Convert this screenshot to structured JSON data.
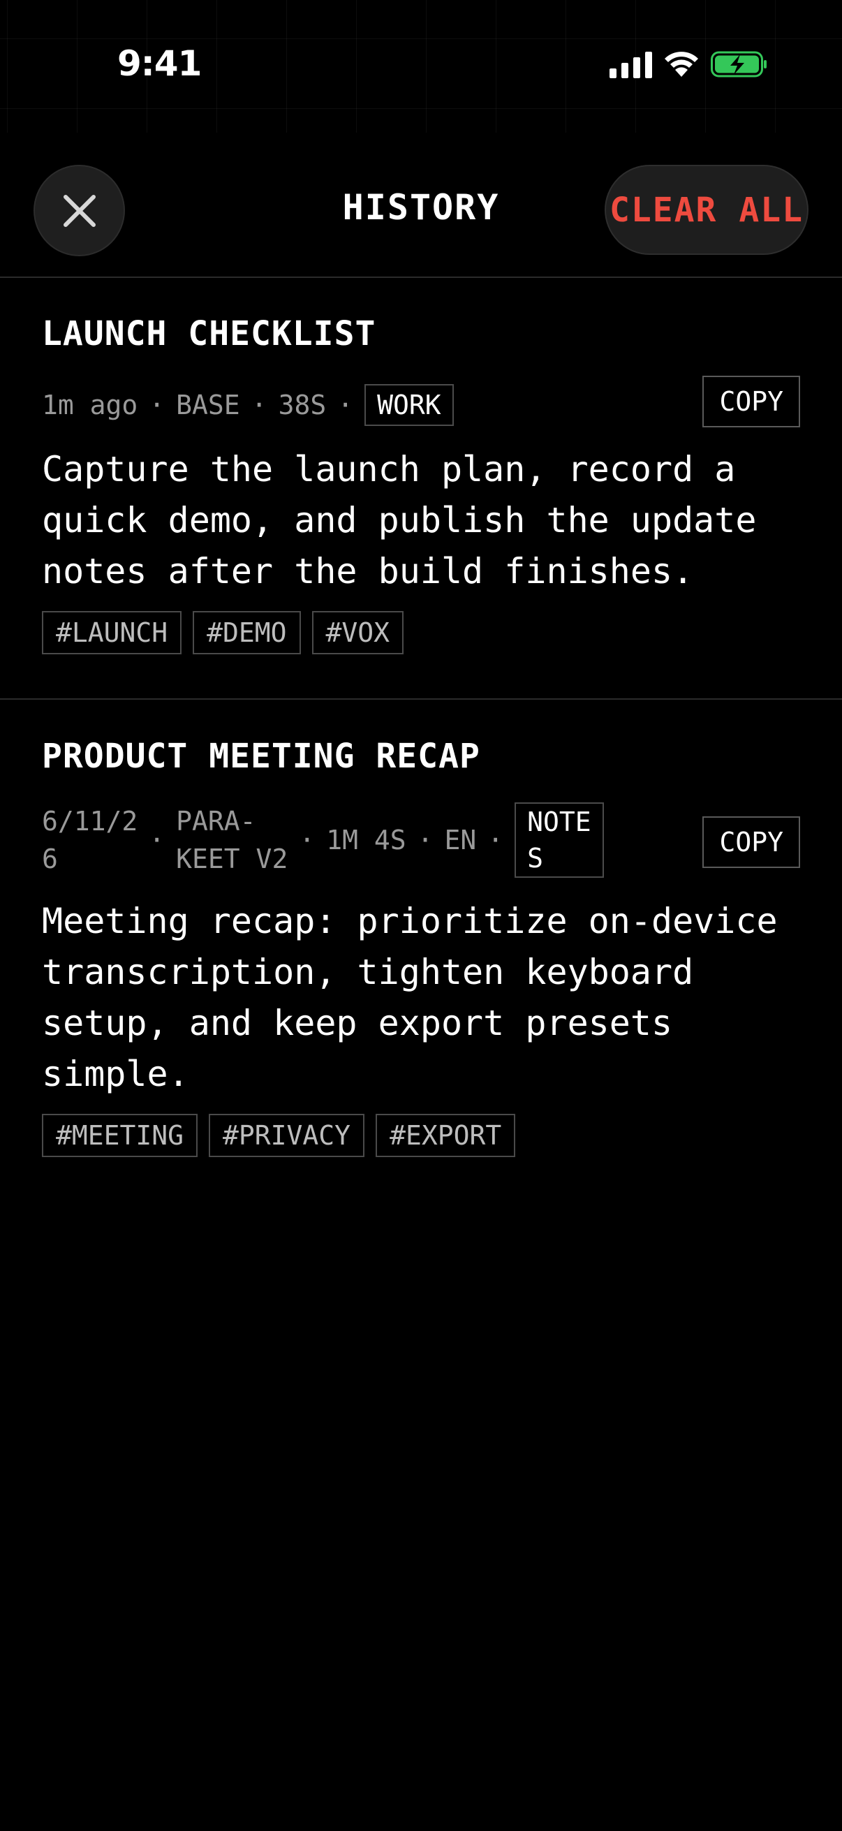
{
  "status_bar": {
    "time": "9:41"
  },
  "header": {
    "title": "HISTORY",
    "clear_all_label": "CLEAR ALL"
  },
  "colors": {
    "accent_red": "#ee4b3f",
    "battery_green": "#34c759"
  },
  "icons": {
    "close": "close-icon",
    "signal": "cellular-signal-icon",
    "wifi": "wifi-icon",
    "battery": "battery-charging-icon"
  },
  "items": [
    {
      "title": "LAUNCH CHECKLIST",
      "time": "1m ago",
      "model": "BASE",
      "duration": "38S",
      "folder": "WORK",
      "copy_label": "COPY",
      "body": "Capture the launch plan, record a quick demo, and publish the update notes after the build finishes.",
      "tags": [
        "#LAUNCH",
        "#DEMO",
        "#VOX"
      ]
    },
    {
      "title": "PRODUCT MEETING RECAP",
      "date_line1": "6/11/2",
      "date_line2": "6",
      "model_line1": "PARA-",
      "model_line2": "KEET V2",
      "duration": "1M 4S",
      "language": "EN",
      "folder_line1": "NOTE",
      "folder_line2": "S",
      "copy_label": "COPY",
      "body": "Meeting recap: prioritize on-device transcription, tighten keyboard setup, and keep export presets simple.",
      "tags": [
        "#MEETING",
        "#PRIVACY",
        "#EXPORT"
      ]
    }
  ]
}
